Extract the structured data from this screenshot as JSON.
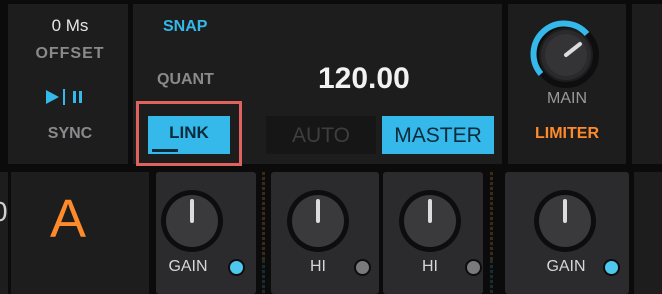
{
  "offset": {
    "value": "0 Ms",
    "label": "OFFSET"
  },
  "sync": {
    "label": "SYNC",
    "play_pause_icon": "play-pause-icon"
  },
  "snap": {
    "label": "SNAP"
  },
  "quant": {
    "label": "QUANT"
  },
  "link": {
    "label": "LINK",
    "highlighted": true
  },
  "tempo": {
    "value": "120.00",
    "auto_label": "AUTO",
    "master_label": "MASTER"
  },
  "main": {
    "label": "MAIN",
    "limiter_label": "LIMITER"
  },
  "deck": {
    "letter": "A",
    "left_partial_digit": "0"
  },
  "knobs": [
    {
      "label": "GAIN",
      "led": "on"
    },
    {
      "label": "HI",
      "led": "off"
    },
    {
      "label": "HI",
      "led": "off"
    },
    {
      "label": "GAIN",
      "led": "on"
    }
  ],
  "colors": {
    "accent_blue": "#35b8ea",
    "accent_orange": "#ff8a2a",
    "highlight_box": "#e0625e"
  }
}
